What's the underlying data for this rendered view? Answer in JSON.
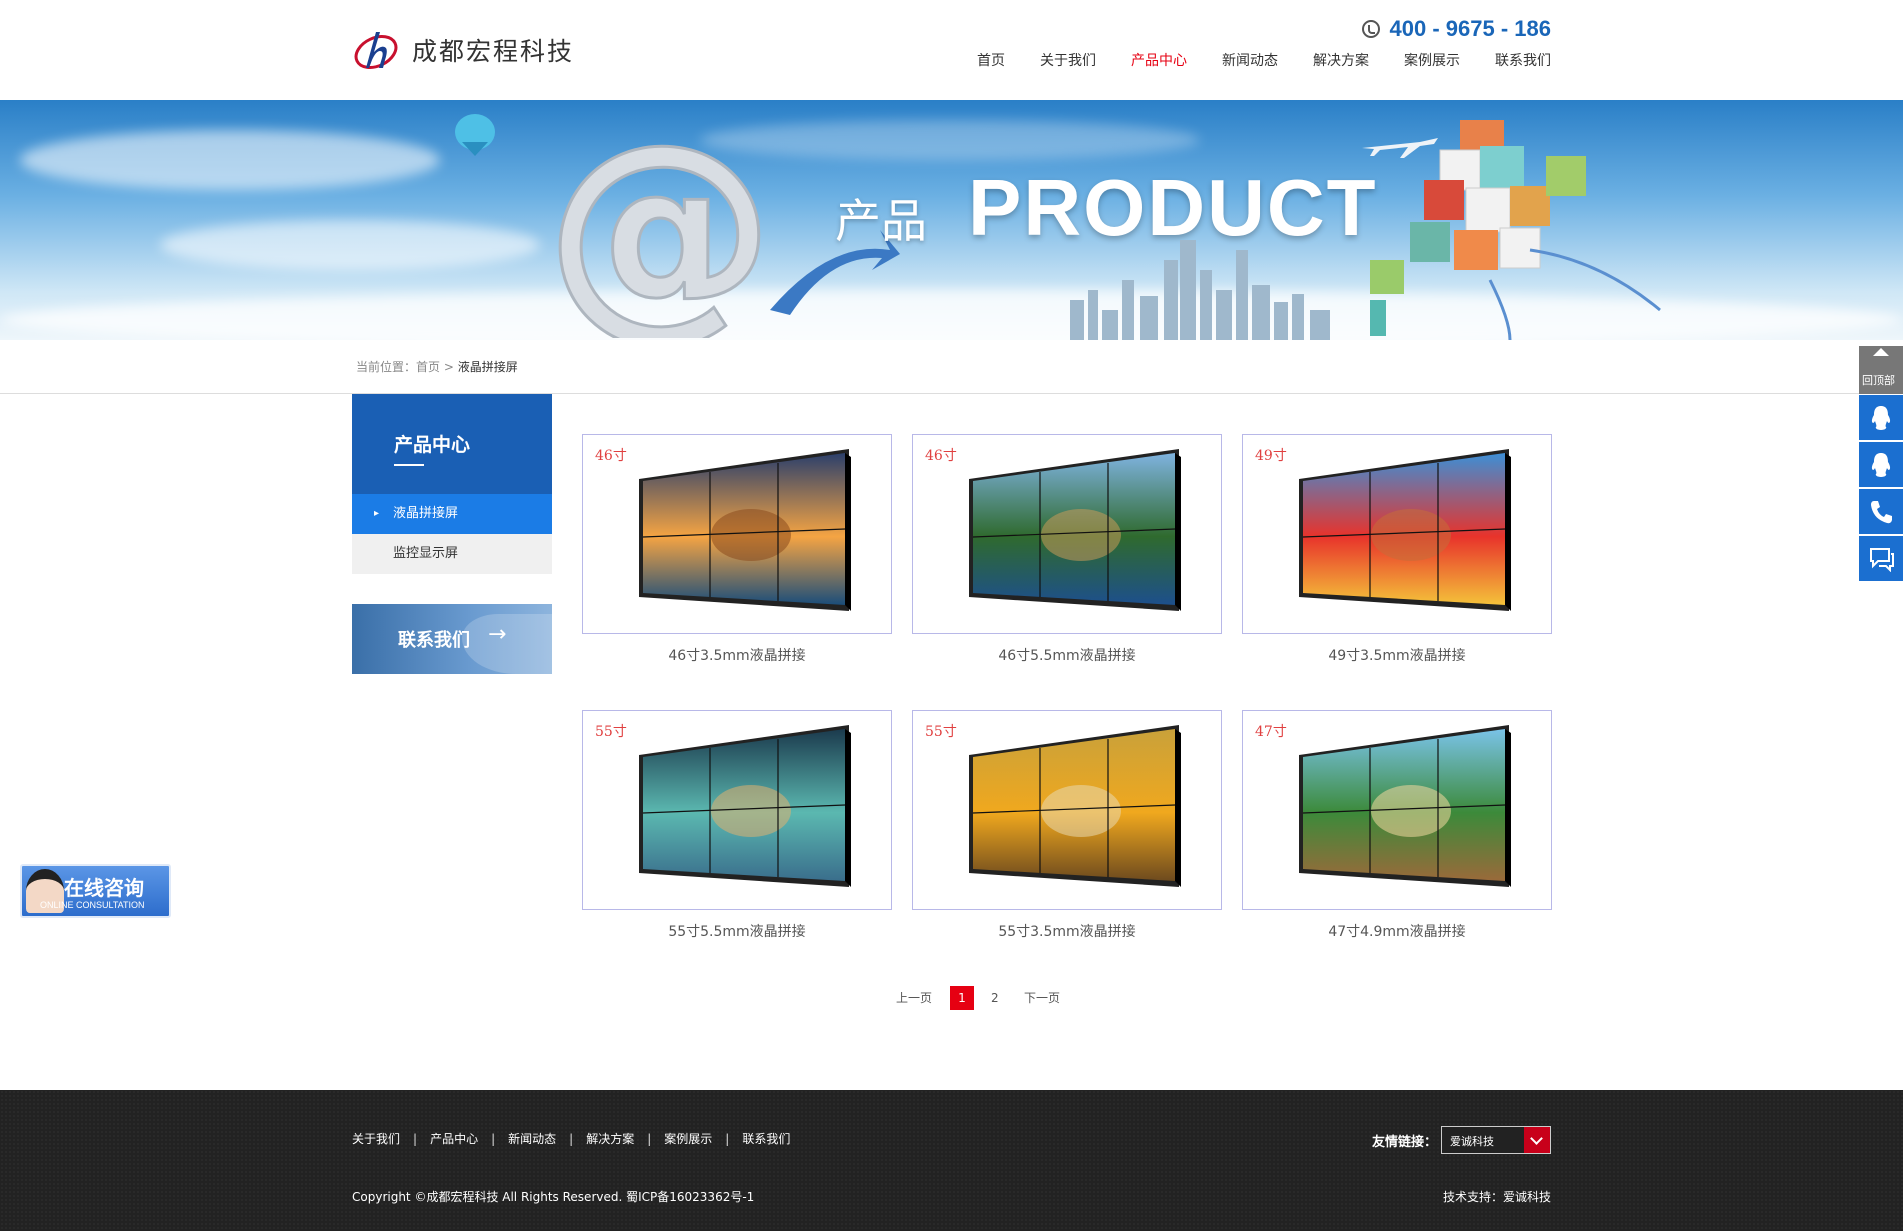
{
  "header": {
    "logo_text": "成都宏程科技",
    "phone": "400 - 9675 - 186",
    "nav": [
      "首页",
      "关于我们",
      "产品中心",
      "新闻动态",
      "解决方案",
      "案例展示",
      "联系我们"
    ],
    "active_nav": "产品中心"
  },
  "banner": {
    "cn": "产品",
    "en": "PRODUCT"
  },
  "breadcrumb": {
    "prefix": "当前位置：",
    "home": "首页",
    "sep": ">",
    "current": "液晶拼接屏"
  },
  "sidebar": {
    "title": "产品中心",
    "items": [
      {
        "label": "液晶拼接屏",
        "active": true
      },
      {
        "label": "监控显示屏",
        "active": false
      }
    ],
    "contact": "联系我们",
    "contact_arrow": "→"
  },
  "products": [
    {
      "size": "46寸",
      "name": "46寸3.5mm液晶拼接",
      "scene": "venice"
    },
    {
      "size": "46寸",
      "name": "46寸5.5mm液晶拼接",
      "scene": "lake"
    },
    {
      "size": "49寸",
      "name": "49寸3.5mm液晶拼接",
      "scene": "balloon"
    },
    {
      "size": "55寸",
      "name": "55寸5.5mm液晶拼接",
      "scene": "waterfall"
    },
    {
      "size": "55寸",
      "name": "55寸3.5mm液晶拼接",
      "scene": "flowers"
    },
    {
      "size": "47寸",
      "name": "47寸4.9mm液晶拼接",
      "scene": "beach"
    }
  ],
  "pager": {
    "prev": "上一页",
    "current": "1",
    "page2": "2",
    "next": "下一页"
  },
  "footer": {
    "links": [
      "关于我们",
      "产品中心",
      "新闻动态",
      "解决方案",
      "案例展示",
      "联系我们"
    ],
    "separator": "|",
    "friend_label": "友情链接：",
    "friend_value": "爱诚科技",
    "copyright": "Copyright ©成都宏程科技 All Rights Reserved. 蜀ICP备16023362号-1",
    "tech": "技术支持：爱诚科技"
  },
  "float": {
    "consult_cn": "在线咨询",
    "consult_en": "ONLINE CONSULTATION",
    "back_top": "回顶部"
  },
  "colors": {
    "brand_blue": "#1a5fb4",
    "accent_red": "#e60012",
    "footer_bg": "#222222"
  }
}
